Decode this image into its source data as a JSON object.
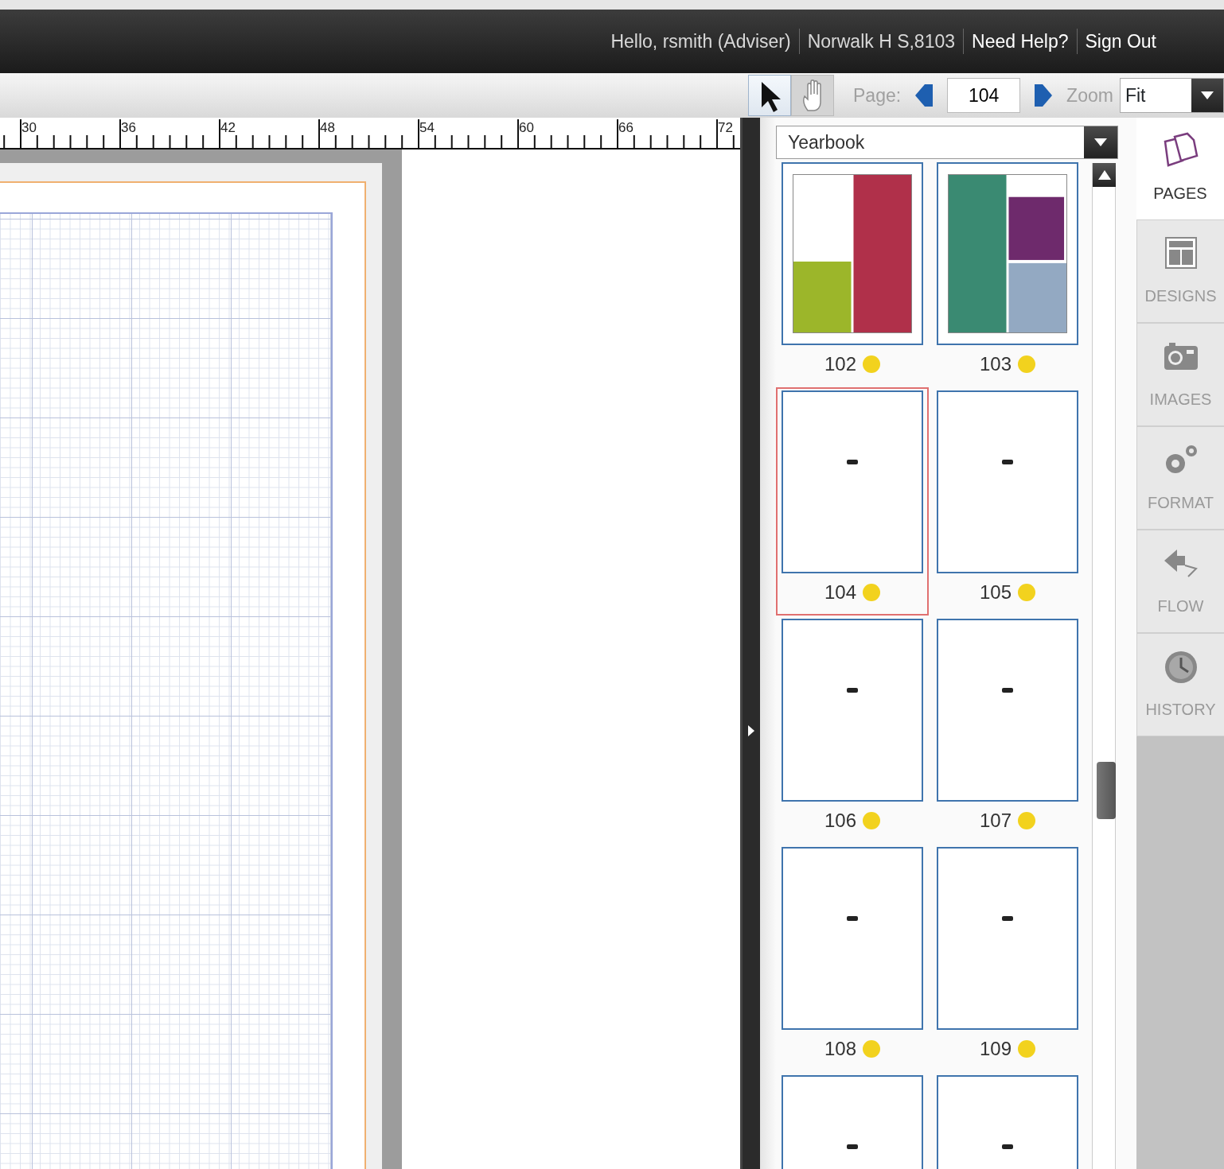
{
  "header": {
    "items": [
      {
        "text": "Hello, rsmith (Adviser)",
        "kind": "text"
      },
      {
        "text": "Norwalk H S,8103",
        "kind": "text"
      },
      {
        "text": "Need Help?",
        "kind": "link"
      },
      {
        "text": "Sign Out",
        "kind": "link"
      }
    ]
  },
  "toolbar": {
    "tools": [
      {
        "selected": true
      },
      {
        "selected": false
      }
    ],
    "page_label": "Page:",
    "page_value": "104",
    "zoom_label": "Zoom",
    "zoom_value": "Fit"
  },
  "ruler": {
    "labels": [
      "30",
      "36",
      "42",
      "48",
      "54",
      "60",
      "66",
      "72"
    ]
  },
  "panel": {
    "book": "Yearbook",
    "pages": [
      {
        "label": "102",
        "kind": "designed",
        "selected": false,
        "color": "#f2d21e",
        "preview": {
          "blocks": [
            {
              "color": "#9cb62a"
            },
            {
              "color": "#b0304a"
            }
          ]
        }
      },
      {
        "label": "103",
        "kind": "designed",
        "selected": false,
        "color": "#f2d21e",
        "preview": {
          "blocks": [
            {
              "color": "#3a8a72"
            },
            {
              "color": "#6e2a6c"
            },
            {
              "color": "#93a9c2"
            }
          ]
        }
      },
      {
        "label": "104",
        "kind": "blank",
        "selected": true,
        "color": "#f2d21e"
      },
      {
        "label": "105",
        "kind": "blank",
        "selected": false,
        "color": "#f2d21e"
      },
      {
        "label": "106",
        "kind": "blank",
        "selected": false,
        "color": "#f2d21e"
      },
      {
        "label": "107",
        "kind": "blank",
        "selected": false,
        "color": "#f2d21e"
      },
      {
        "label": "108",
        "kind": "blank",
        "selected": false,
        "color": "#f2d21e"
      },
      {
        "label": "109",
        "kind": "blank",
        "selected": false,
        "color": "#f2d21e"
      },
      {
        "kind": "blank",
        "selected": false
      },
      {
        "kind": "blank",
        "selected": false
      }
    ]
  },
  "sidebar": {
    "tabs": [
      {
        "label": "PAGES",
        "selected": true
      },
      {
        "label": "DESIGNS",
        "selected": false
      },
      {
        "label": "IMAGES",
        "selected": false
      },
      {
        "label": "FORMAT",
        "selected": false
      },
      {
        "label": "FLOW",
        "selected": false
      },
      {
        "label": "HISTORY",
        "selected": false
      }
    ]
  }
}
